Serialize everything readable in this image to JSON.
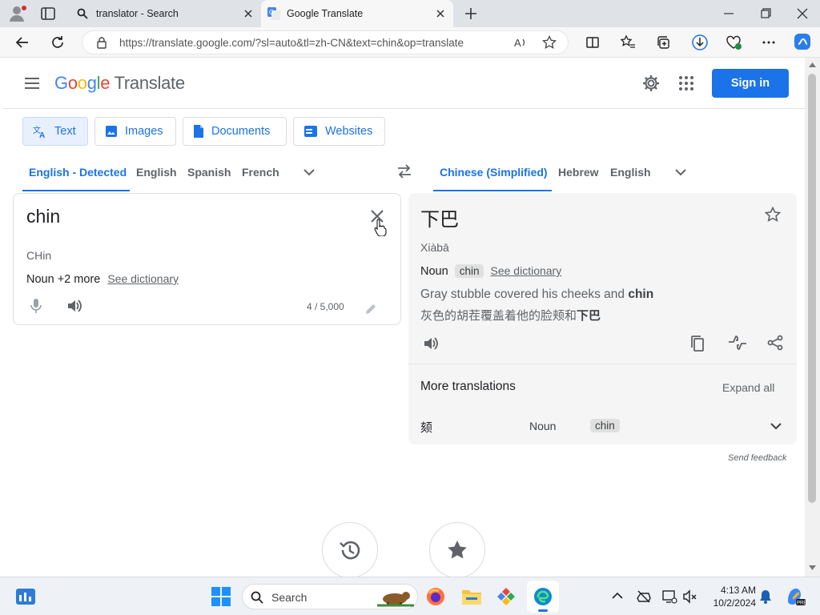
{
  "browser": {
    "tabs": [
      {
        "title": "translator - Search",
        "active": false
      },
      {
        "title": "Google Translate",
        "active": true
      }
    ],
    "url": "https://translate.google.com/?sl=auto&tl=zh-CN&text=chin&op=translate"
  },
  "header": {
    "logo_google": "Google",
    "logo_product": "Translate",
    "signin_label": "Sign in"
  },
  "modes": [
    {
      "label": "Text",
      "selected": true
    },
    {
      "label": "Images"
    },
    {
      "label": "Documents"
    },
    {
      "label": "Websites"
    }
  ],
  "source_langs": [
    "English - Detected",
    "English",
    "Spanish",
    "French"
  ],
  "target_langs": [
    "Chinese (Simplified)",
    "Hebrew",
    "English"
  ],
  "source": {
    "text": "chin",
    "transliteration": "CHin",
    "pos_summary": "Noun +2 more",
    "see_dictionary": "See dictionary",
    "char_count": "4 / 5,000"
  },
  "target": {
    "text": "下巴",
    "romanization": "Xiàbā",
    "pos": "Noun",
    "pos_chip": "chin",
    "see_dictionary": "See dictionary",
    "example_en_before": "Gray stubble covered his cheeks and ",
    "example_en_bold": "chin",
    "example_zh_before": "灰色的胡茬覆盖着他的脸颊和",
    "example_zh_bold": "下巴"
  },
  "more_translations": {
    "heading": "More translations",
    "expand_all": "Expand all",
    "rows": [
      {
        "word": "颏",
        "pos": "Noun",
        "chip": "chin"
      }
    ]
  },
  "send_feedback": "Send feedback",
  "taskbar": {
    "search_placeholder": "Search",
    "time": "4:13 AM",
    "date": "10/2/2024"
  },
  "colors": {
    "accent": "#1a73e8",
    "tab_bar": "#dfe3e8",
    "target_panel": "#f5f5f5"
  }
}
